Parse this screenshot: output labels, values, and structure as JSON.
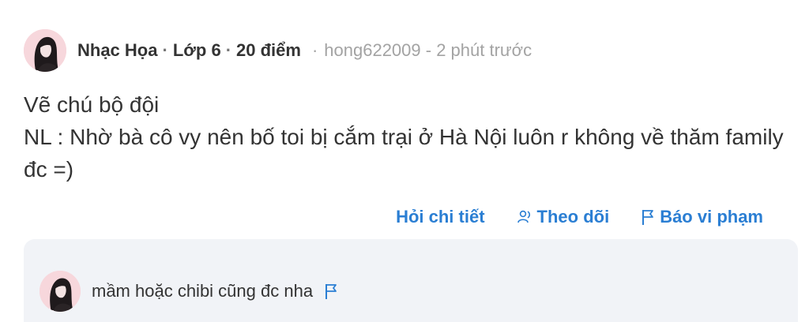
{
  "question": {
    "author": "Nhạc Họa",
    "grade": "Lớp 6",
    "points": "20 điểm",
    "username": "hong622009",
    "time": "2 phút trước",
    "lines": [
      "Vẽ chú bộ đội",
      "NL : Nhờ bà cô vy nên bố toi bị cắm trại ở Hà Nội luôn r không về thăm family đc =)"
    ]
  },
  "actions": {
    "ask_detail": "Hỏi chi tiết",
    "follow": "Theo dõi",
    "report": "Báo vi phạm"
  },
  "comment": {
    "text": "mầm hoặc chibi cũng đc nha"
  },
  "colors": {
    "link": "#2a7ed3",
    "panel_bg": "#f1f3f7",
    "muted_text": "#a3a3a3",
    "avatar_bg": "#f7d7dc"
  },
  "icons": {
    "follow": "user-follow-icon",
    "report": "flag-icon"
  }
}
